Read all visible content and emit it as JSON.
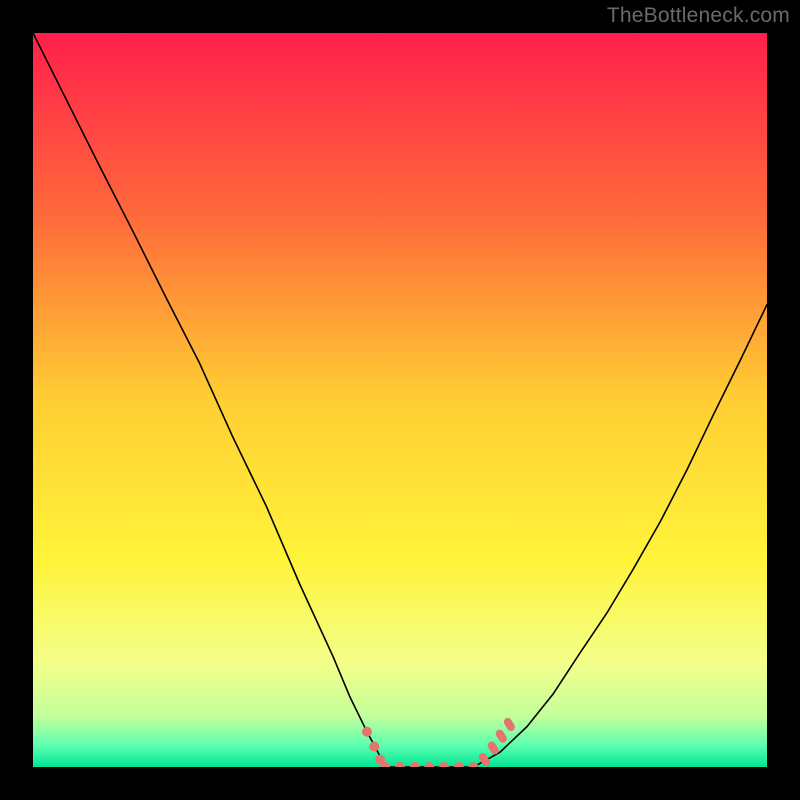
{
  "watermark": "TheBottleneck.com",
  "chart_data": {
    "type": "line",
    "title": "",
    "xlabel": "",
    "ylabel": "",
    "xlim": [
      0,
      100
    ],
    "ylim": [
      0,
      100
    ],
    "background_gradient": {
      "stops": [
        {
          "offset": 0.0,
          "color": "#ff1f4c"
        },
        {
          "offset": 0.25,
          "color": "#ff6a3a"
        },
        {
          "offset": 0.5,
          "color": "#ffce33"
        },
        {
          "offset": 0.72,
          "color": "#fff43a"
        },
        {
          "offset": 0.86,
          "color": "#f3ff8a"
        },
        {
          "offset": 0.93,
          "color": "#c4ff9a"
        },
        {
          "offset": 0.97,
          "color": "#5fffb0"
        },
        {
          "offset": 1.0,
          "color": "#00e795"
        }
      ]
    },
    "series": [
      {
        "name": "left-branch",
        "x": [
          0.0,
          4.5,
          9.0,
          13.6,
          18.1,
          22.7,
          27.2,
          31.8,
          36.3,
          40.9,
          43.2,
          45.4,
          47.0,
          48.0
        ],
        "values": [
          100.0,
          91.0,
          82.0,
          73.0,
          64.0,
          55.0,
          45.0,
          35.5,
          25.0,
          15.0,
          9.5,
          5.0,
          2.0,
          0.0
        ]
      },
      {
        "name": "bottom-flat",
        "x": [
          48.0,
          50.0,
          52.0,
          54.0,
          56.0,
          58.0,
          60.0
        ],
        "values": [
          0.0,
          0.0,
          0.0,
          0.0,
          0.0,
          0.0,
          0.0
        ]
      },
      {
        "name": "right-branch",
        "x": [
          60.0,
          63.6,
          67.3,
          70.9,
          74.5,
          78.2,
          81.8,
          85.5,
          89.1,
          92.7,
          96.4,
          100.0
        ],
        "values": [
          0.0,
          2.0,
          5.5,
          10.0,
          15.5,
          21.0,
          27.0,
          33.5,
          40.5,
          48.0,
          55.5,
          63.0
        ]
      }
    ],
    "markers": [
      {
        "name": "left-dot-upper",
        "x": 45.5,
        "y": 4.8
      },
      {
        "name": "left-dot-mid",
        "x": 46.5,
        "y": 2.8
      },
      {
        "name": "left-dot-lower",
        "x": 47.3,
        "y": 1.0
      },
      {
        "name": "floor-dot-1",
        "x": 48.0,
        "y": 0.0
      },
      {
        "name": "floor-dot-2",
        "x": 50.0,
        "y": 0.0
      },
      {
        "name": "floor-dot-3",
        "x": 52.0,
        "y": 0.0
      },
      {
        "name": "floor-dot-4",
        "x": 54.0,
        "y": 0.0
      },
      {
        "name": "floor-dot-5",
        "x": 56.0,
        "y": 0.0
      },
      {
        "name": "floor-dot-6",
        "x": 58.0,
        "y": 0.0
      },
      {
        "name": "floor-dot-7",
        "x": 60.0,
        "y": 0.0
      },
      {
        "name": "right-pill-a",
        "x": 61.5,
        "y": 1.0
      },
      {
        "name": "right-pill-b",
        "x": 62.7,
        "y": 2.6
      },
      {
        "name": "right-pill-c",
        "x": 63.8,
        "y": 4.2
      },
      {
        "name": "right-pill-d",
        "x": 64.9,
        "y": 5.8
      }
    ],
    "grid": false,
    "legend_position": "none"
  }
}
